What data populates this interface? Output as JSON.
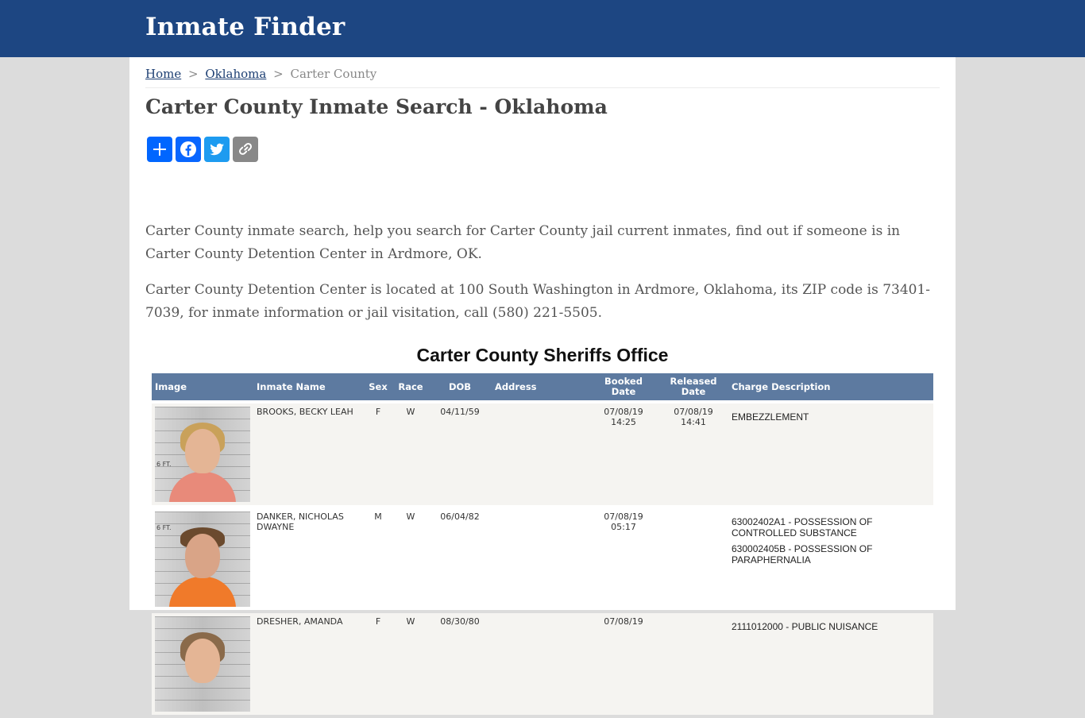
{
  "site": {
    "brand": "Inmate Finder"
  },
  "breadcrumb": {
    "home": "Home",
    "state": "Oklahoma",
    "current": "Carter County",
    "separator": ">"
  },
  "page": {
    "title": "Carter County Inmate Search - Oklahoma"
  },
  "share": {
    "buttons": [
      {
        "name": "share-add",
        "icon": "plus-icon",
        "color": "#0166ff"
      },
      {
        "name": "facebook",
        "icon": "facebook-icon",
        "color": "#0866ff"
      },
      {
        "name": "twitter",
        "icon": "twitter-icon",
        "color": "#1d9bf0"
      },
      {
        "name": "copy-link",
        "icon": "link-icon",
        "color": "#888888"
      }
    ]
  },
  "intro": {
    "p1": "Carter County inmate search, help you search for Carter County jail current inmates, find out if someone is in Carter County Detention Center in Ardmore, OK.",
    "p2": "Carter County Detention Center is located at 100 South Washington in Ardmore, Oklahoma, its ZIP code is 73401-7039, for inmate information or jail visitation, call (580) 221-5505."
  },
  "roster": {
    "title": "Carter County Sheriffs Office",
    "columns": {
      "image": "Image",
      "name": "Inmate Name",
      "sex": "Sex",
      "race": "Race",
      "dob": "DOB",
      "address": "Address",
      "booked": "Booked Date",
      "released": "Released Date",
      "charge": "Charge Description"
    },
    "rows": [
      {
        "name": "BROOKS, BECKY LEAH",
        "sex": "F",
        "race": "W",
        "dob": "04/11/59",
        "address": "",
        "booked": "07/08/19 14:25",
        "released": "07/08/19 14:41",
        "charges": [
          "EMBEZZLEMENT"
        ]
      },
      {
        "name": "DANKER, NICHOLAS DWAYNE",
        "sex": "M",
        "race": "W",
        "dob": "06/04/82",
        "address": "",
        "booked": "07/08/19 05:17",
        "released": "",
        "charges": [
          "63002402A1 - POSSESSION OF CONTROLLED SUBSTANCE",
          "630002405B - POSSESSION OF PARAPHERNALIA"
        ]
      },
      {
        "name": "DRESHER, AMANDA",
        "sex": "F",
        "race": "W",
        "dob": "08/30/80",
        "address": "",
        "booked": "07/08/19",
        "released": "",
        "charges": [
          "2111012000 - PUBLIC NUISANCE"
        ]
      }
    ]
  },
  "mugshot_tag": "6 FT."
}
